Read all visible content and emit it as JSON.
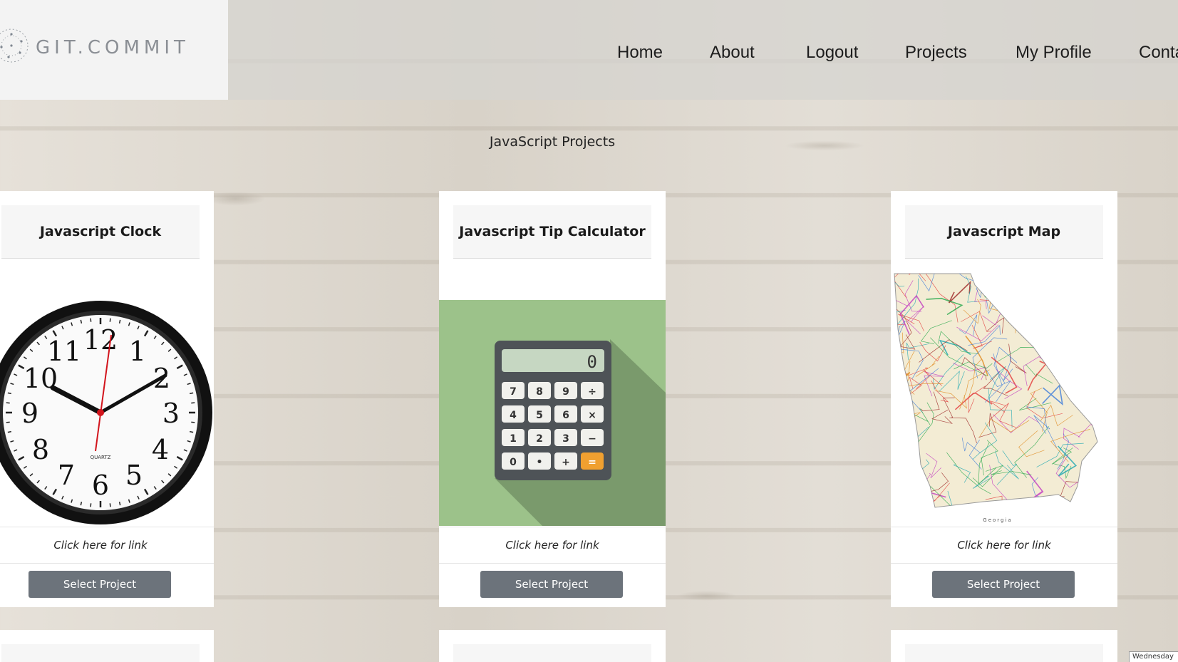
{
  "brand": {
    "name": "GIT.COMMIT",
    "icon": "globe-network-logo",
    "color": "#8b8f95"
  },
  "nav": {
    "items": [
      {
        "label": "Home"
      },
      {
        "label": "About"
      },
      {
        "label": "Logout"
      },
      {
        "label": "Projects"
      },
      {
        "label": "My Profile"
      },
      {
        "label": "Conta"
      }
    ]
  },
  "section": {
    "title": "JavaScript Projects"
  },
  "projects": [
    {
      "title": "Javascript Clock",
      "image": "wall-clock-image",
      "link_label": "Click here for link",
      "button_label": "Select Project"
    },
    {
      "title": "Javascript Tip Calculator",
      "image": "calculator-image",
      "link_label": "Click here for link",
      "button_label": "Select Project"
    },
    {
      "title": "Javascript Map",
      "image": "georgia-map-image",
      "map_caption": "Georgia",
      "link_label": "Click here for link",
      "button_label": "Select Project"
    }
  ],
  "clock": {
    "numerals": [
      "12",
      "1",
      "2",
      "3",
      "4",
      "5",
      "6",
      "7",
      "8",
      "9",
      "10",
      "11"
    ],
    "brand": "QUARTZ"
  },
  "calculator": {
    "display": "0",
    "keys": [
      "7",
      "8",
      "9",
      "÷",
      "4",
      "5",
      "6",
      "×",
      "1",
      "2",
      "3",
      "−",
      "0",
      "•",
      "+",
      "="
    ]
  },
  "taskbar": {
    "date_text": "Wednesday"
  },
  "colors": {
    "button": "#6c737b",
    "calculator_bg": "#9cc28a",
    "calculator_accent": "#f0a030"
  }
}
